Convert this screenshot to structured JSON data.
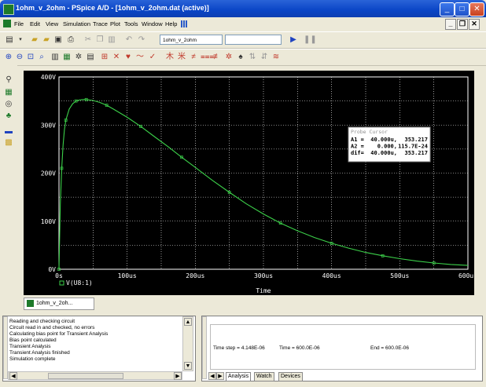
{
  "window": {
    "title": "1ohm_v_2ohm - PSpice A/D  - [1ohm_v_2ohm.dat (active)]",
    "minimize": "_",
    "maximize": "□",
    "close": "✕"
  },
  "menu": {
    "items": [
      "File",
      "Edit",
      "View",
      "Simulation",
      "Trace",
      "Plot",
      "Tools",
      "Window",
      "Help"
    ],
    "mdi_min": "_",
    "mdi_restore": "❐",
    "mdi_close": "✕"
  },
  "toolbar": {
    "profile_value": "1ohm_v_2ohm",
    "run_icon": "run-play-icon",
    "pause_icon": "pause-icon"
  },
  "plot": {
    "x_label": "Time",
    "trace_name": "V(U8:1)",
    "cursor": {
      "title": "Probe Cursor",
      "rows": [
        {
          "label": "A1 =",
          "x": "40.000u,",
          "y": "353.217"
        },
        {
          "label": "A2 =",
          "x": "0.000,",
          "y": "115.7E-24"
        },
        {
          "label": "dif=",
          "x": "40.000u,",
          "y": "353.217"
        }
      ]
    }
  },
  "chart_data": {
    "type": "line",
    "xlabel": "Time",
    "ylabel": "",
    "x_ticks": [
      "0s",
      "100us",
      "200us",
      "300us",
      "400us",
      "500us",
      "600us"
    ],
    "y_ticks": [
      "0V",
      "100V",
      "200V",
      "300V",
      "400V"
    ],
    "xlim": [
      0,
      600
    ],
    "ylim": [
      0,
      400
    ],
    "series": [
      {
        "name": "V(U8:1)",
        "color": "#3cd14a",
        "x": [
          0,
          1,
          2,
          4,
          6,
          8,
          10,
          15,
          20,
          25,
          30,
          35,
          40,
          50,
          60,
          70,
          80,
          100,
          120,
          140,
          160,
          180,
          200,
          225,
          250,
          275,
          300,
          325,
          350,
          375,
          400,
          425,
          450,
          475,
          500,
          525,
          550,
          575,
          600
        ],
        "y": [
          0,
          72,
          135,
          210,
          258,
          290,
          310,
          333,
          344,
          350,
          352,
          353,
          353,
          351,
          347,
          341,
          333,
          316,
          297,
          276,
          255,
          233,
          212,
          185,
          160,
          136,
          115,
          96,
          80,
          66,
          54,
          44,
          35,
          28,
          22,
          17,
          13,
          10,
          8
        ]
      }
    ]
  },
  "output": {
    "lines": [
      "Reading and checking circuit",
      "Circuit read in and checked, no errors",
      "Calculating bias point for Transient Analysis",
      "Bias point calculated",
      "Transient Analysis",
      "Transient Analysis finished",
      "Simulation complete"
    ]
  },
  "status": {
    "time_step": "Time step = 4.148E-06",
    "time": "Time = 600.0E-06",
    "end": "End = 600.0E-06"
  },
  "tabs": {
    "plot_tab": "1ohm_v_2oh...",
    "bottom": [
      "Analysis",
      "Watch",
      "Devices"
    ]
  },
  "colors": {
    "plot_bg": "#000000",
    "grid": "#ffffff",
    "trace": "#3cd14a"
  }
}
